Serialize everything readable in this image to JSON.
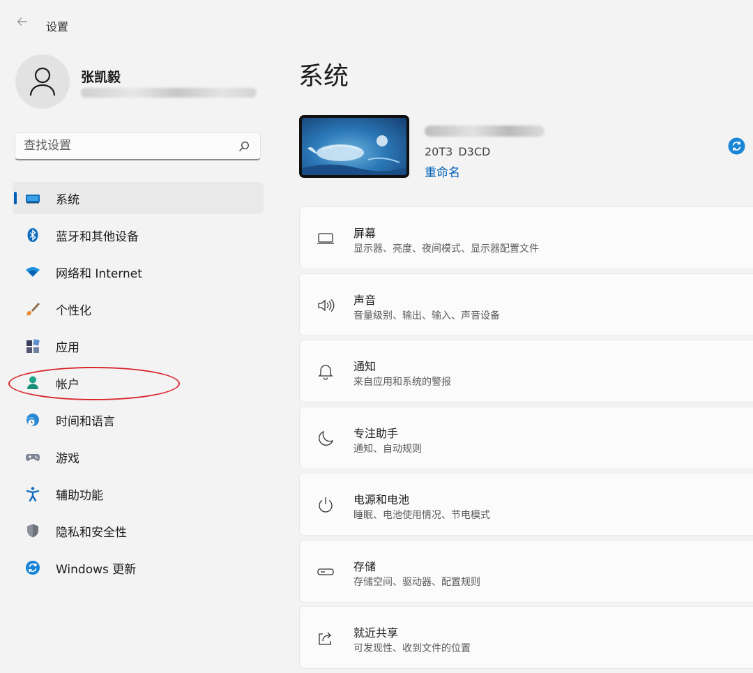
{
  "window": {
    "title": "设置"
  },
  "profile": {
    "name": "张凯毅"
  },
  "search": {
    "placeholder": "查找设置"
  },
  "nav": {
    "items": [
      {
        "label": "系统",
        "icon": "monitor-icon",
        "active": true
      },
      {
        "label": "蓝牙和其他设备",
        "icon": "bluetooth-icon"
      },
      {
        "label": "网络和 Internet",
        "icon": "wifi-icon"
      },
      {
        "label": "个性化",
        "icon": "paintbrush-icon"
      },
      {
        "label": "应用",
        "icon": "apps-icon"
      },
      {
        "label": "帐户",
        "icon": "account-icon",
        "annotated": true
      },
      {
        "label": "时间和语言",
        "icon": "globe-clock-icon"
      },
      {
        "label": "游戏",
        "icon": "gamepad-icon"
      },
      {
        "label": "辅助功能",
        "icon": "accessibility-icon"
      },
      {
        "label": "隐私和安全性",
        "icon": "shield-icon"
      },
      {
        "label": "Windows 更新",
        "icon": "windows-update-icon"
      }
    ]
  },
  "main": {
    "title": "系统",
    "device": {
      "model": "20T3  D3CD",
      "rename_label": "重命名"
    },
    "cards": [
      {
        "title": "屏幕",
        "desc": "显示器、亮度、夜间模式、显示器配置文件",
        "icon": "display-icon"
      },
      {
        "title": "声音",
        "desc": "音量级别、输出、输入、声音设备",
        "icon": "speaker-icon"
      },
      {
        "title": "通知",
        "desc": "来自应用和系统的警报",
        "icon": "bell-icon"
      },
      {
        "title": "专注助手",
        "desc": "通知、自动规则",
        "icon": "moon-icon"
      },
      {
        "title": "电源和电池",
        "desc": "睡眠、电池使用情况、节电模式",
        "icon": "power-icon"
      },
      {
        "title": "存储",
        "desc": "存储空间、驱动器、配置规则",
        "icon": "storage-icon"
      },
      {
        "title": "就近共享",
        "desc": "可发现性、收到文件的位置",
        "icon": "share-icon"
      }
    ]
  },
  "colors": {
    "accent": "#005fb8",
    "annotation": "#d8262d",
    "background": "#f3f3f3"
  }
}
